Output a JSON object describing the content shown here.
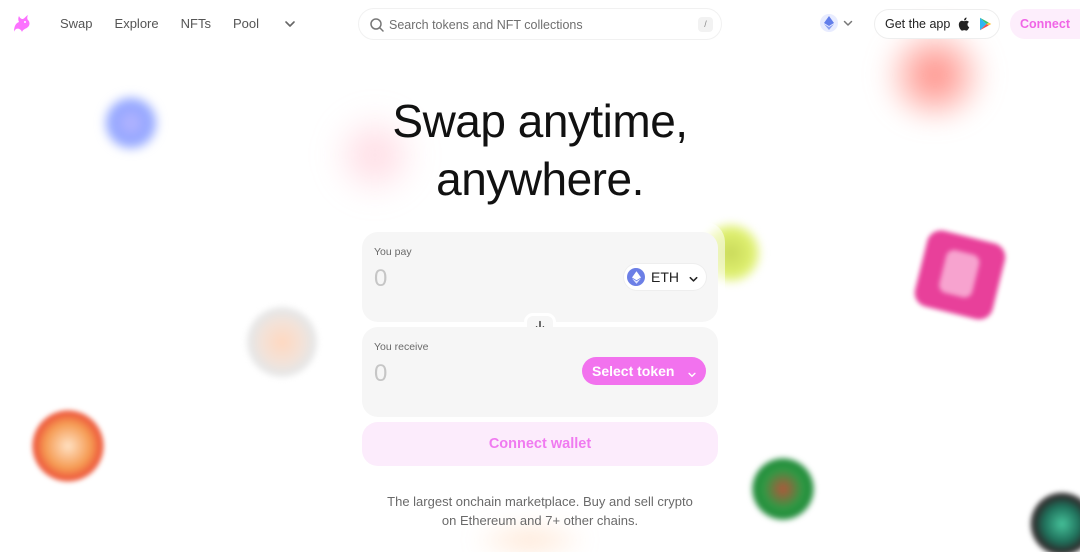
{
  "nav": {
    "links": [
      "Swap",
      "Explore",
      "NFTs",
      "Pool"
    ],
    "logo_icon": "unicorn-icon",
    "more_icon": "chevron-down-icon"
  },
  "search": {
    "placeholder": "Search tokens and NFT collections",
    "shortcut": "/"
  },
  "header": {
    "chain_icon": "ethereum-icon",
    "get_app_label": "Get the app",
    "connect_label": "Connect"
  },
  "hero": {
    "title_line1": "Swap anytime,",
    "title_line2": "anywhere."
  },
  "swap": {
    "pay_label": "You pay",
    "pay_amount_placeholder": "0",
    "pay_token": "ETH",
    "receive_label": "You receive",
    "receive_amount_placeholder": "0",
    "select_token_label": "Select token",
    "connect_wallet_label": "Connect wallet"
  },
  "tagline": {
    "line1": "The largest onchain marketplace. Buy and sell crypto",
    "line2": "on Ethereum and 7+ other chains."
  },
  "colors": {
    "accent": "#f272ee",
    "accent_soft": "#fcecfc",
    "panel_bg": "#f6f6f6",
    "eth": "#6c7fe6"
  }
}
